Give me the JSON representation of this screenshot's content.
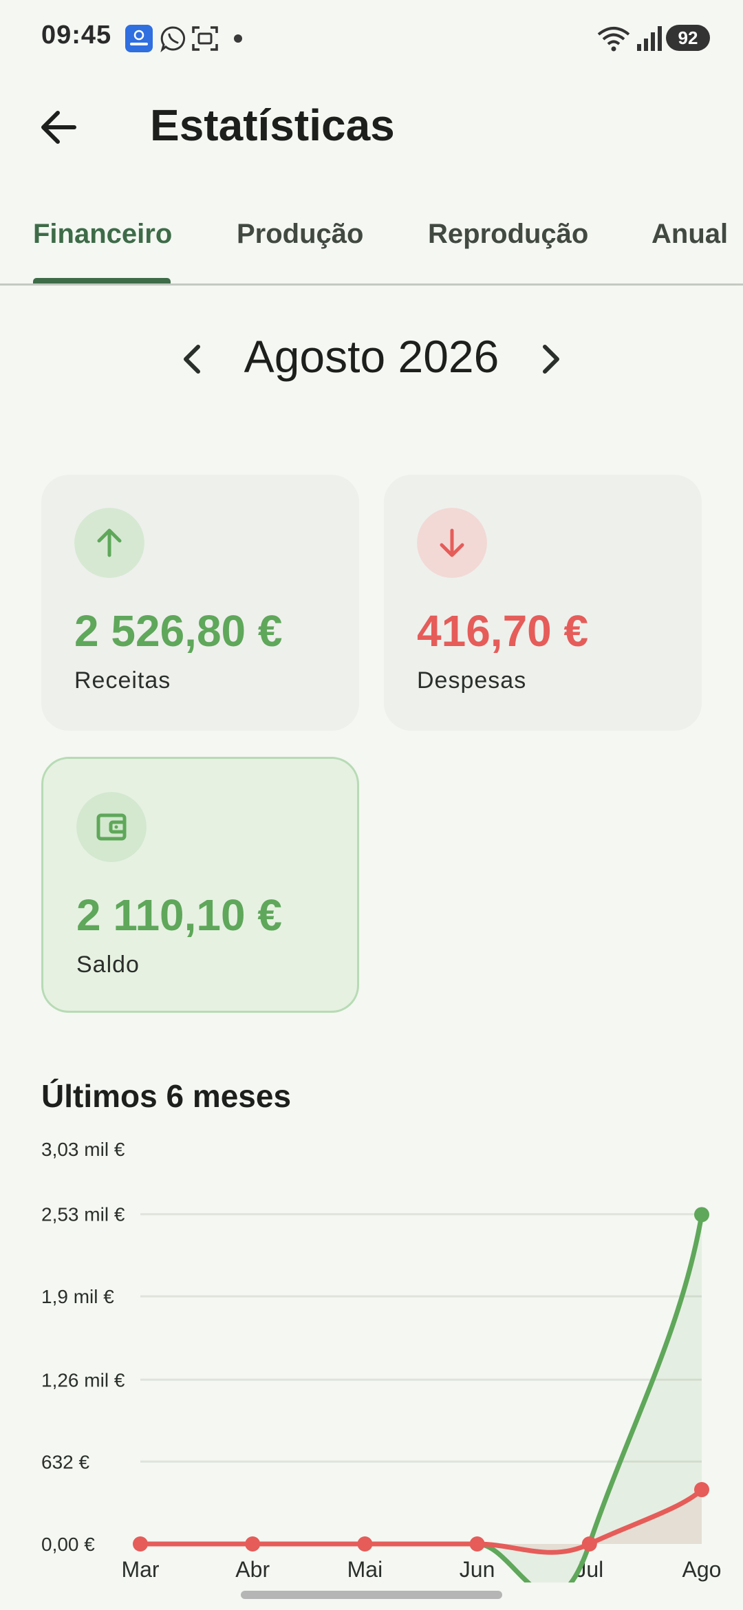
{
  "status_bar": {
    "time": "09:45",
    "battery": "92",
    "icons": [
      "app-notification-icon",
      "whatsapp-icon",
      "screenshot-icon",
      "wifi-icon",
      "signal-icon"
    ]
  },
  "header": {
    "title": "Estatísticas",
    "back_icon": "arrow-left-icon"
  },
  "tabs": [
    {
      "label": "Financeiro",
      "active": true
    },
    {
      "label": "Produção",
      "active": false
    },
    {
      "label": "Reprodução",
      "active": false
    },
    {
      "label": "Anual",
      "active": false
    }
  ],
  "month_selector": {
    "label": "Agosto 2026",
    "prev_icon": "chevron-left-icon",
    "next_icon": "chevron-right-icon"
  },
  "cards": {
    "income": {
      "amount": "2 526,80 €",
      "label": "Receitas",
      "icon": "arrow-up-icon"
    },
    "expenses": {
      "amount": "416,70 €",
      "label": "Despesas",
      "icon": "arrow-down-icon"
    },
    "balance": {
      "amount": "2 110,10 €",
      "label": "Saldo",
      "icon": "wallet-icon"
    }
  },
  "colors": {
    "accent": "#3e6b48",
    "income": "#5fa75a",
    "expense": "#e55c59",
    "background": "#f4f7f2"
  },
  "chart_section": {
    "title": "Últimos 6 meses"
  },
  "chart_data": {
    "type": "line",
    "categories": [
      "Mar",
      "Abr",
      "Mai",
      "Jun",
      "Jul",
      "Ago"
    ],
    "series": [
      {
        "color": "#5fa75a",
        "values": [
          0,
          0,
          0,
          0,
          0,
          2526.8
        ]
      },
      {
        "color": "#e55c59",
        "values": [
          0,
          0,
          0,
          0,
          0,
          416.7
        ]
      }
    ],
    "ylim": [
      0,
      3030
    ],
    "y_ticks": [
      {
        "value": 0,
        "label": "0,00 €"
      },
      {
        "value": 632,
        "label": "632 €"
      },
      {
        "value": 1260,
        "label": "1,26 mil €"
      },
      {
        "value": 1900,
        "label": "1,9 mil €"
      },
      {
        "value": 2530,
        "label": "2,53 mil €"
      },
      {
        "value": 3030,
        "label": "3,03 mil €"
      }
    ],
    "grid": true
  }
}
